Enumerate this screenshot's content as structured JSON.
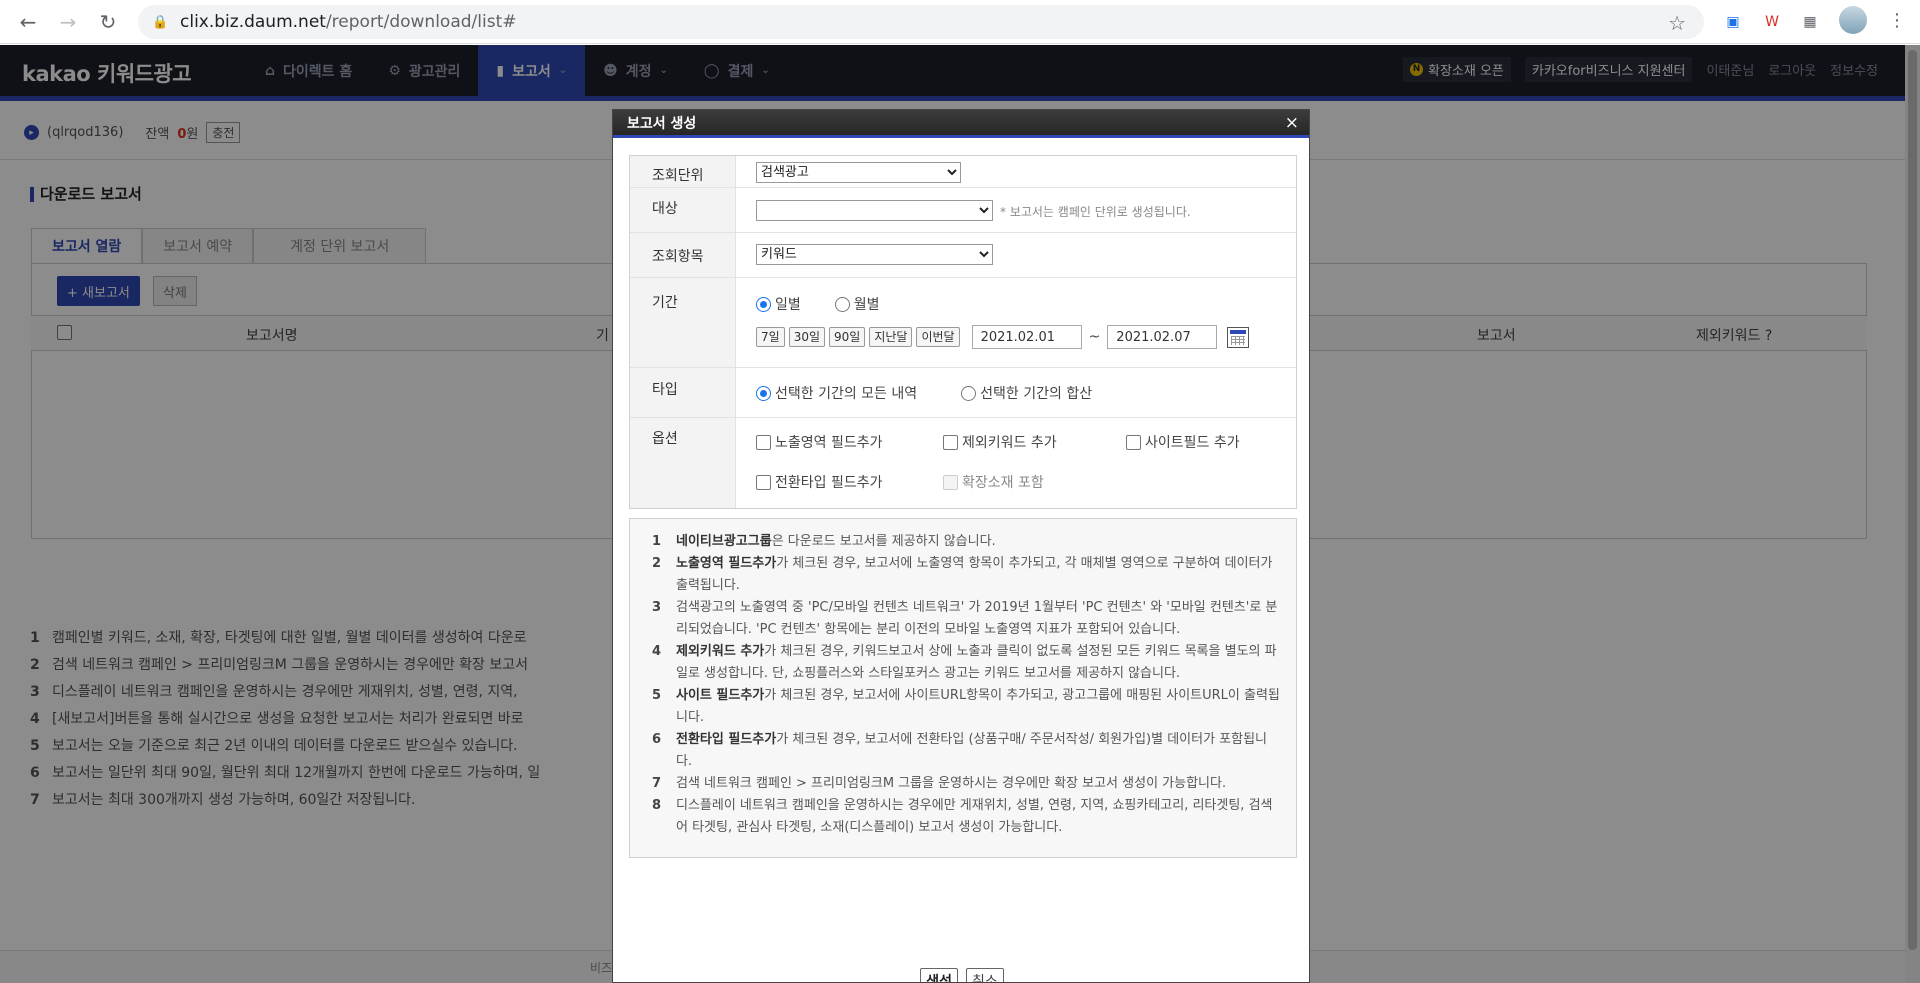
{
  "browser": {
    "url_host": "clix.biz.daum.net",
    "url_path": "/report/download/list#"
  },
  "header": {
    "logo": "kakao 키워드광고",
    "nav": [
      {
        "label": "다이렉트 홈",
        "icon": "home-icon"
      },
      {
        "label": "광고관리",
        "icon": "gear-icon"
      },
      {
        "label": "보고서",
        "icon": "bar-chart-icon",
        "active": true
      },
      {
        "label": "계정",
        "icon": "person-icon"
      },
      {
        "label": "결제",
        "icon": "coins-icon"
      }
    ],
    "util": {
      "ext_open": "확장소재 오픈",
      "biz_center": "카카오for비즈니스 지원센터",
      "user": "이태준님",
      "logout": "로그아웃",
      "edit_info": "정보수정"
    }
  },
  "account": {
    "id": "(qlrqod136)",
    "balance_label": "잔액",
    "balance_value": "0",
    "balance_unit": "원",
    "charge": "충전"
  },
  "page": {
    "title": "다운로드 보고서",
    "tabs": [
      "보고서 열람",
      "보고서 예약",
      "계정 단위 보고서"
    ],
    "new_report": "+ 새보고서",
    "delete": "삭제",
    "columns": {
      "name": "보고서명",
      "period": "기",
      "report": "보고서",
      "excluded": "제외키워드 ?"
    },
    "notes": [
      "캠페인별 키워드, 소재, 확장, 타겟팅에 대한 일별, 월별 데이터를 생성하여 다운로",
      "검색 네트워크 캠페인 > 프리미엄링크M 그룹을 운영하시는 경우에만 확장 보고서",
      "디스플레이 네트워크 캠페인을 운영하시는 경우에만 게재위치, 성별, 연령, 지역, ",
      "[새보고서]버튼을 통해 실시간으로 생성을 요청한 보고서는 처리가 완료되면 바로",
      "보고서는 오늘 기준으로 최근 2년 이내의 데이터를 다운로드 받으실수 있습니다.",
      "보고서는 일단위 최대 90일, 월단위 최대 12개월까지 한번에 다운로드 가능하며, 일",
      "보고서는 최대 300개까지 생성 가능하며, 60일간 저장됩니다."
    ],
    "footer_text": "비즈"
  },
  "modal": {
    "title": "보고서 생성",
    "close": "×",
    "fields": {
      "unit_label": "조회단위",
      "unit_value": "검색광고",
      "target_label": "대상",
      "target_value": "",
      "target_hint": "* 보고서는 캠페인 단위로 생성됩니다.",
      "item_label": "조회항목",
      "item_value": "키워드",
      "period_label": "기간",
      "daily": "일별",
      "monthly": "월별",
      "presets": [
        "7일",
        "30일",
        "90일",
        "지난달",
        "이번달"
      ],
      "date_from": "2021.02.01",
      "date_sep": "~",
      "date_to": "2021.02.07",
      "type_label": "타입",
      "type_all": "선택한 기간의 모든 내역",
      "type_sum": "선택한 기간의 합산",
      "option_label": "옵션",
      "opt_exposure": "노출영역 필드추가",
      "opt_excluded": "제외키워드 추가",
      "opt_site": "사이트필드 추가",
      "opt_conversion": "전환타입 필드추가",
      "opt_extension": "확장소재 포함"
    },
    "guide": [
      {
        "n": "1",
        "b": "네이티브광고그룹",
        "t": "은 다운로드 보고서를 제공하지 않습니다."
      },
      {
        "n": "2",
        "b": "노출영역 필드추가",
        "t": "가 체크된 경우, 보고서에 노출영역 항목이 추가되고, 각 매체별 영역으로 구분하여 데이터가 출력됩니다."
      },
      {
        "n": "3",
        "b": "",
        "t": "검색광고의 노출영역 중 'PC/모바일 컨텐츠 네트워크' 가 2019년 1월부터 'PC 컨텐츠' 와 '모바일 컨텐츠'로 분리되었습니다. 'PC 컨텐츠' 항목에는 분리 이전의 모바일 노출영역 지표가 포함되어 있습니다."
      },
      {
        "n": "4",
        "b": "제외키워드 추가",
        "t": "가 체크된 경우, 키워드보고서 상에 노출과 클릭이 없도록 설정된 모든 키워드 목록을 별도의 파일로 생성합니다. 단, 쇼핑플러스와 스타일포커스 광고는 키워드 보고서를 제공하지 않습니다."
      },
      {
        "n": "5",
        "b": "사이트 필드추가",
        "t": "가 체크된 경우, 보고서에 사이트URL항목이 추가되고, 광고그룹에 매핑된 사이트URL이 출력됩니다."
      },
      {
        "n": "6",
        "b": "전환타입 필드추가",
        "t": "가 체크된 경우, 보고서에 전환타입 (상품구매/ 주문서작성/ 회원가입)별 데이터가 포함됩니다."
      },
      {
        "n": "7",
        "b": "",
        "t": "검색 네트워크 캠페인 > 프리미엄링크M 그룹을 운영하시는 경우에만 확장 보고서 생성이 가능합니다."
      },
      {
        "n": "8",
        "b": "",
        "t": "디스플레이 네트워크 캠페인을 운영하시는 경우에만 게재위치, 성별, 연령, 지역, 쇼핑카테고리, 리타겟팅, 검색어 타겟팅, 관심사 타겟팅, 소재(디스플레이) 보고서 생성이 가능합니다."
      }
    ],
    "create": "생성",
    "cancel": "취소"
  }
}
